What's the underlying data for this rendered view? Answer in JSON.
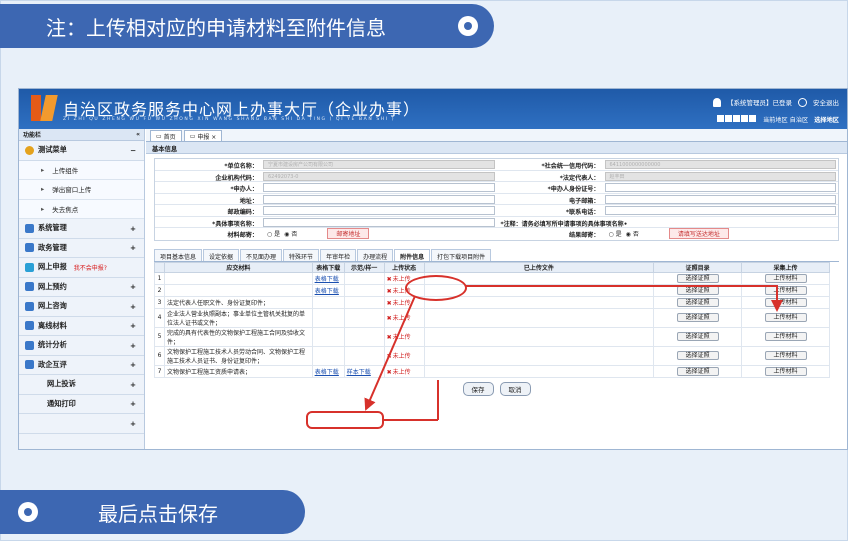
{
  "callouts": {
    "top_text": "注：上传相对应的申请材料至附件信息",
    "bottom_text": "最后点击保存"
  },
  "header": {
    "title": "自治区政务服务中心网上办事大厅（企业办事）",
    "subtitle": "ZI ZHI QU ZHENG WU FU WU ZHONG XIN WANG SHANG BAN SHI DA TING ( QI YE BAN SHI )",
    "user_text": "【系统管理员】已登录",
    "logout": "安全退出",
    "region_text": "当前地区  自治区",
    "select_region": "选择地区"
  },
  "sidebar": {
    "header": "功能栏",
    "collapse": "«",
    "items": [
      {
        "label": "测试菜单",
        "sign": "−",
        "expanded": true
      },
      {
        "label": "系统管理",
        "sign": "+"
      },
      {
        "label": "政务管理",
        "sign": "+"
      },
      {
        "label": "网上申报",
        "sign": "",
        "note": "我不会申报?"
      },
      {
        "label": "网上预约",
        "sign": "+"
      },
      {
        "label": "网上咨询",
        "sign": "+"
      },
      {
        "label": "离线材料",
        "sign": "+"
      },
      {
        "label": "统计分析",
        "sign": "+"
      },
      {
        "label": "政企互评",
        "sign": "+"
      },
      {
        "label": "网上投诉",
        "sign": "+"
      },
      {
        "label": "通知打印",
        "sign": "+"
      }
    ],
    "subitems": [
      "上传组件",
      "弹出窗口上传",
      "失去焦点"
    ],
    "bottom_sign": "+"
  },
  "tabs": [
    "首页",
    "申报 ×"
  ],
  "section_title": "基本信息",
  "form": {
    "unit_name_label": "*单位名称：",
    "unit_name_value": "宁夏市建设房产公司有限公司",
    "credit_code_label": "*社会统一信用代码：",
    "credit_code_value": "6411000000000000",
    "org_code_label": "企业机构代码：",
    "org_code_value": "62492073-0",
    "legal_rep_label": "*法定代表人：",
    "legal_rep_value": "赵丰田",
    "applicant_label": "*申办人：",
    "applicant_id_label": "*申办人身份证号：",
    "address_label": "地址：",
    "email_label": "电子邮箱：",
    "postal_label": "邮政编码：",
    "phone_label": "*联系电话：",
    "item_name_label": "*具体事项名称：",
    "note_label": "*注释：请务必填写所申请事项的具体事项名称•",
    "mail_material_label": "材料邮寄：",
    "radio_yes": "是",
    "radio_no": "否",
    "mail_address_btn": "邮寄地址",
    "result_mail_label": "结果邮寄：",
    "fill_address_btn": "请填写送达地址"
  },
  "panel_tabs": [
    "项目基本信息",
    "设定依据",
    "不见面办理",
    "特殊环节",
    "年审年检",
    "办理流程",
    "附件信息",
    "打包下载项目附件"
  ],
  "active_panel_tab": "附件信息",
  "table": {
    "headers": [
      "应交材料",
      "表格下载",
      "示范/样一",
      "上传状态",
      "已上传文件",
      "证照目录",
      "采集上传"
    ],
    "rows": [
      {
        "n": "1",
        "material": "",
        "download": "表格下载",
        "sample": "",
        "status": "未上传"
      },
      {
        "n": "2",
        "material": "",
        "download": "表格下载",
        "sample": "",
        "status": "未上传"
      },
      {
        "n": "3",
        "material": "法定代表人任职文件、身份证复印件；",
        "download": "",
        "sample": "",
        "status": "未上传"
      },
      {
        "n": "4",
        "material": "企业法人营业执照副本；事业单位主管机关批复的单位法人证书或文件；",
        "download": "",
        "sample": "",
        "status": "未上传"
      },
      {
        "n": "5",
        "material": "完成的具有代表性的文物保护工程施工合同及验收文件；",
        "download": "",
        "sample": "",
        "status": "未上传"
      },
      {
        "n": "6",
        "material": "文物保护工程施工技术人员劳动合同、文物保护工程施工技术人员证书、身份证复印件；",
        "download": "",
        "sample": "",
        "status": "未上传"
      },
      {
        "n": "7",
        "material": "文物保护工程施工资质申请表；",
        "download": "表格下载",
        "sample": "样本下载",
        "status": "未上传"
      }
    ],
    "select_cert": "选择证照",
    "upload_btn": "上传材料"
  },
  "actions": {
    "save": "保存",
    "cancel": "取消"
  },
  "colors": {
    "accent": "#3d67b2",
    "annotation": "#d7312b"
  }
}
